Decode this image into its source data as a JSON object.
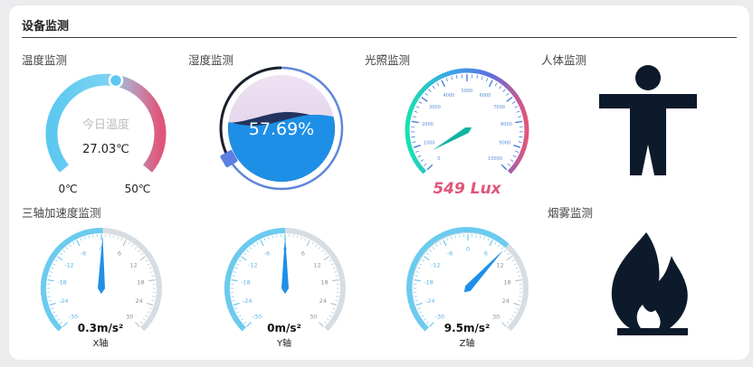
{
  "panel": {
    "title": "设备监测"
  },
  "temperature": {
    "title": "温度监测",
    "center_label": "今日温度",
    "value_text": "27.03℃",
    "value": 27.03,
    "min_label": "0℃",
    "max_label": "50℃",
    "min": 0,
    "max": 50,
    "colors": {
      "cold": "#5cc8f0",
      "mid": "#b6a0c0",
      "hot": "#e0557a"
    }
  },
  "humidity": {
    "title": "湿度监测",
    "value_text": "57.69%",
    "value": 57.69,
    "colors": {
      "water": "#1e8fe6",
      "ring": "#5f86d8",
      "marker": "#5b7fe3"
    }
  },
  "light": {
    "title": "光照监测",
    "value_text": "549 Lux",
    "value": 549,
    "ticks": [
      "0",
      "1000",
      "2000",
      "3000",
      "4000",
      "5000",
      "6000",
      "7000",
      "8000",
      "9000",
      "10000"
    ],
    "colors": {
      "value_text": "#e0557a",
      "needle": "#12b3a3"
    }
  },
  "human": {
    "title": "人体监测",
    "icon": "person-icon"
  },
  "accel": {
    "title": "三轴加速度监测",
    "ticks": [
      "-30",
      "-24",
      "-18",
      "-12",
      "-6",
      "0",
      "6",
      "12",
      "18",
      "24",
      "30"
    ],
    "axes": [
      {
        "value": 0.3,
        "value_text": "0.3m/s²",
        "label": "X轴"
      },
      {
        "value": 0,
        "value_text": "0m/s²",
        "label": "Y轴"
      },
      {
        "value": 9.5,
        "value_text": "9.5m/s²",
        "label": "Z轴"
      }
    ],
    "colors": {
      "fill": "#6bcbef",
      "track": "#d6dde3",
      "needle": "#1f8fe8"
    }
  },
  "smoke": {
    "title": "烟雾监测",
    "icon": "fire-icon"
  }
}
